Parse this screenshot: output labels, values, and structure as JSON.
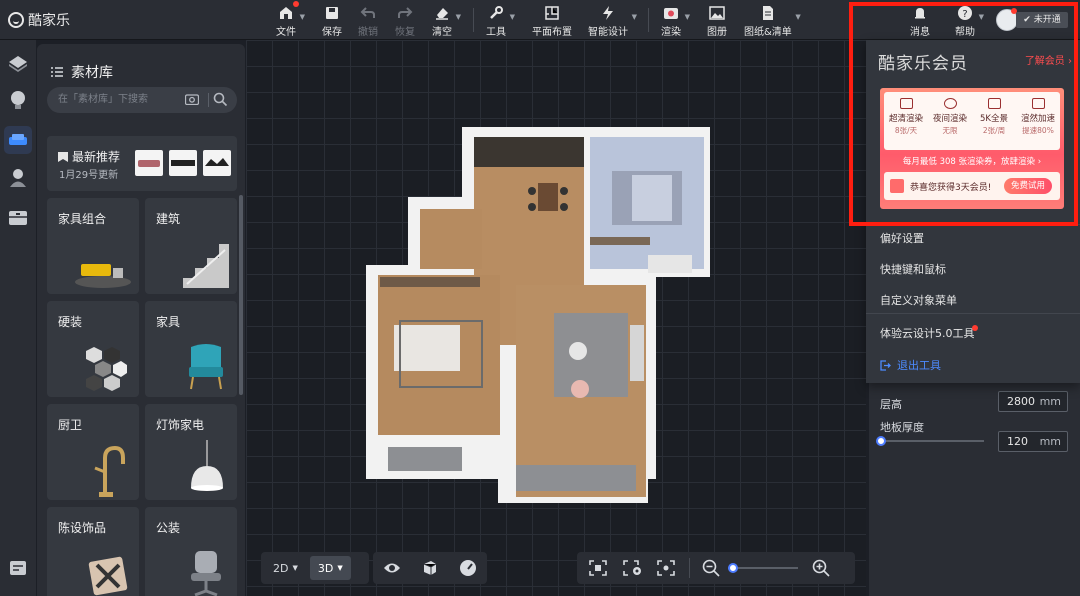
{
  "app": {
    "title": "酷家乐"
  },
  "toolbar": {
    "file": "文件",
    "save": "保存",
    "undo": "撤销",
    "redo": "恢复",
    "clear": "清空",
    "tools": "工具",
    "layout": "平面布置",
    "smart": "智能设计",
    "render": "渲染",
    "album": "图册",
    "drawings": "图纸&清单",
    "messages": "消息",
    "help": "帮助",
    "vip_status": "未开通"
  },
  "library": {
    "title": "素材库",
    "search_placeholder": "在「素材库」下搜索",
    "recommend_title": "最新推荐",
    "recommend_sub": "1月29号更新",
    "categories": [
      "家具组合",
      "建筑",
      "硬装",
      "家具",
      "厨卫",
      "灯饰家电",
      "陈设饰品",
      "公装"
    ]
  },
  "view": {
    "mode_2d": "2D",
    "mode_3d": "3D"
  },
  "menu": {
    "vip_title": "酷家乐会员",
    "vip_more": "了解会员 ›",
    "perks": [
      {
        "title": "超清渲染",
        "sub": "8张/天"
      },
      {
        "title": "夜间渲染",
        "sub": "无限"
      },
      {
        "title": "5K全景",
        "sub": "2张/周"
      },
      {
        "title": "渲然加速",
        "sub": "提速80%"
      }
    ],
    "vip_promo": "每月最低 308 张渲染券，放肆渲染 ›",
    "trial_text": "恭喜您获得3天会员!",
    "trial_button": "免费试用",
    "items": [
      "偏好设置",
      "快捷键和鼠标",
      "自定义对象菜单",
      "体验云设计5.0工具",
      "退出工具"
    ]
  },
  "properties": {
    "floor_height_label": "层高",
    "floor_height_value": "2800",
    "unit": "mm",
    "floor_thickness_label": "地板厚度",
    "floor_thickness_value": "120"
  },
  "colors": {
    "accent": "#4d7cff",
    "alert": "#ff3b30",
    "highlight_box": "#ff1e10"
  }
}
